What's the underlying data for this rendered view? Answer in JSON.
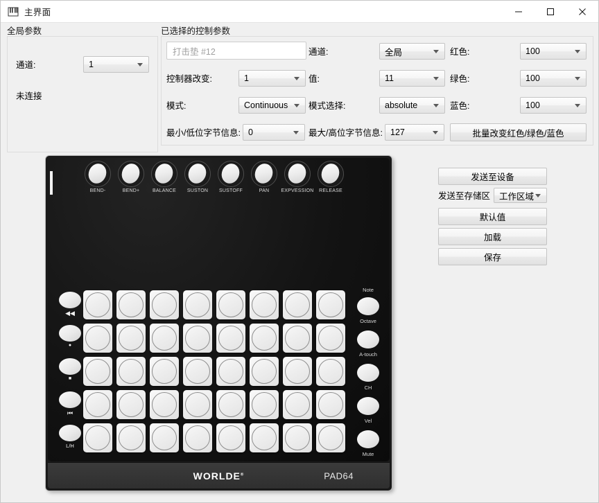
{
  "window": {
    "title": "主界面",
    "icon": "piano-keys-icon",
    "minimize_label": "—",
    "maximize_label": "□",
    "close_label": "✕"
  },
  "global_params": {
    "title": "全局参数",
    "channel_label": "通道:",
    "channel_value": "1",
    "status_text": "未连接"
  },
  "selected_params": {
    "title": "已选择的控制参数",
    "name_placeholder": "打击垫 #12",
    "fields": [
      {
        "label": "控制器改变:",
        "value": "1"
      },
      {
        "label": "模式:",
        "value": "Continuous"
      },
      {
        "label": "最小/低位字节信息:",
        "value": "0"
      },
      {
        "label": "通道:",
        "value": "全局"
      },
      {
        "label": "值:",
        "value": "11"
      },
      {
        "label": "模式选择:",
        "value": "absolute"
      },
      {
        "label": "最大/高位字节信息:",
        "value": "127"
      },
      {
        "label": "红色:",
        "value": "100"
      },
      {
        "label": "绿色:",
        "value": "100"
      },
      {
        "label": "蓝色:",
        "value": "100"
      }
    ],
    "batch_rgb_button": "批量改变红色/绿色/蓝色"
  },
  "actions": {
    "send_to_device": "发送至设备",
    "send_to_storage_label": "发送至存储区",
    "storage_value": "工作区域",
    "default": "默认值",
    "load": "加载",
    "save": "保存"
  },
  "device": {
    "brand": "WORLDE",
    "brand_mark": "®",
    "model": "PAD64",
    "knobs": [
      "BEND-",
      "BEND+",
      "BALANCE",
      "SUSTON",
      "SUSTOFF",
      "PAN",
      "EXPVESSION",
      "RELEASE"
    ],
    "right_labels": [
      "Note",
      "Octave",
      "A-touch",
      "CH",
      "Vel",
      "Mute"
    ],
    "left_labels": [
      "◀◀",
      "●",
      "■",
      "⏮",
      "L/H"
    ],
    "grid_rows": 5,
    "grid_cols": 8
  },
  "colors": {
    "window_bg": "#f0f0f0",
    "titlebar_bg": "#ffffff",
    "device_body": "#1a1a1a",
    "pad_face": "#ededed",
    "border": "#dcdcdc"
  }
}
